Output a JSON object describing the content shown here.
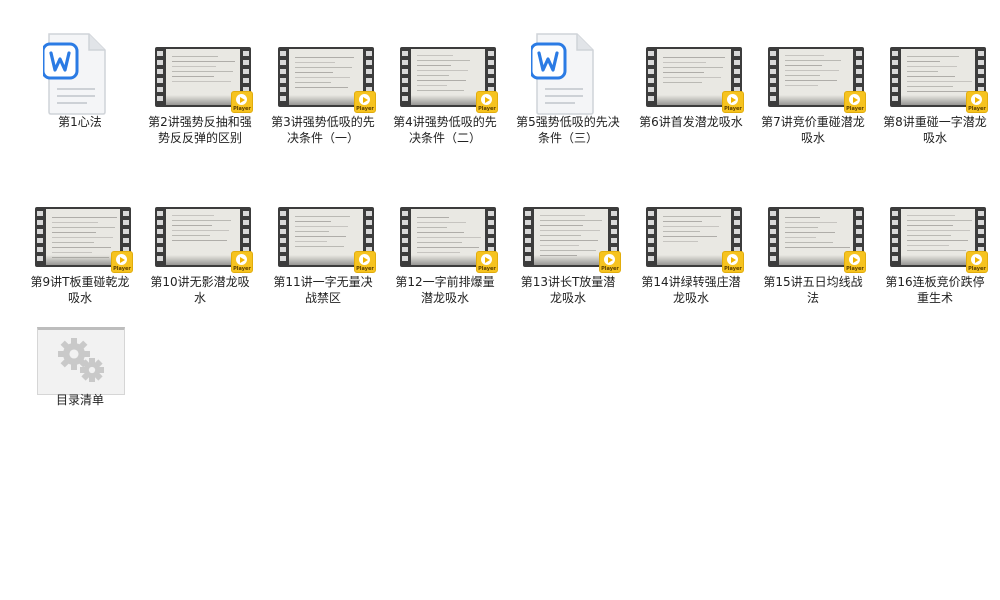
{
  "files": [
    {
      "name": "第1心法",
      "type": "docx"
    },
    {
      "name": "第2讲强势反抽和强势反反弹的区别",
      "type": "video"
    },
    {
      "name": "第3讲强势低吸的先决条件（一）",
      "type": "video"
    },
    {
      "name": "第4讲强势低吸的先决条件（二）",
      "type": "video"
    },
    {
      "name": "第5强势低吸的先决条件（三）",
      "type": "docx"
    },
    {
      "name": "第6讲首发潜龙吸水",
      "type": "video"
    },
    {
      "name": "第7讲竞价重碰潜龙吸水",
      "type": "video"
    },
    {
      "name": "第8讲重碰一字潜龙吸水",
      "type": "video"
    },
    {
      "name": "第9讲T板重碰乾龙吸水",
      "type": "video"
    },
    {
      "name": "第10讲无影潜龙吸水",
      "type": "video"
    },
    {
      "name": "第11讲一字无量决战禁区",
      "type": "video"
    },
    {
      "name": "第12一字前排爆量潜龙吸水",
      "type": "video"
    },
    {
      "name": "第13讲长T放量潜龙吸水",
      "type": "video"
    },
    {
      "name": "第14讲绿转强庄潜龙吸水",
      "type": "video"
    },
    {
      "name": "第15讲五日均线战法",
      "type": "video"
    },
    {
      "name": "第16连板竞价跌停重生术",
      "type": "video"
    },
    {
      "name": "目录清单",
      "type": "settings"
    }
  ],
  "badge_text": "Player",
  "colors": {
    "word_blue": "#2b7be4",
    "badge_yellow": "#f6c320"
  }
}
